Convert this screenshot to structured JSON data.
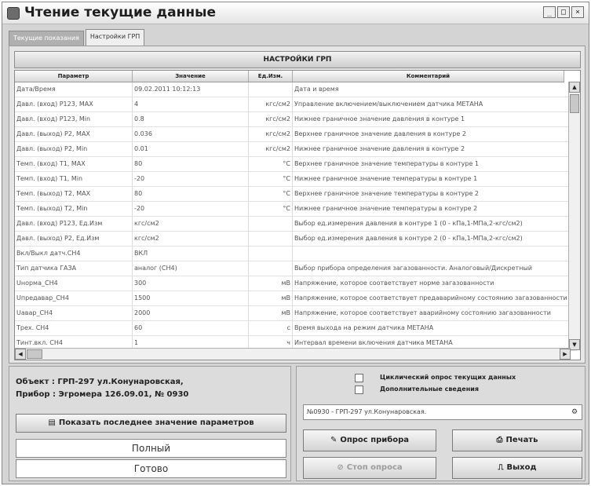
{
  "window": {
    "title": "Чтение текущие данные",
    "controls": {
      "minimize": "_",
      "maximize": "□",
      "close": "×"
    }
  },
  "tabs": [
    {
      "label": "Текущие показания",
      "active": false
    },
    {
      "label": "Настройки ГРП",
      "active": true
    }
  ],
  "settings": {
    "section_title": "НАСТРОЙКИ ГРП",
    "columns": [
      "Параметр",
      "Значение",
      "Ед.Изм.",
      "Комментарий"
    ],
    "rows": [
      [
        "Дата/Время",
        "09.02.2011 10:12:13",
        "",
        "Дата и время"
      ],
      [
        "Давл. (вход) Р123, MAX",
        "4",
        "кгс/см2",
        "Управление включением/выключением датчика МЕТАНА"
      ],
      [
        "Давл. (вход) Р123, Min",
        "0.8",
        "кгс/см2",
        "Нижнее граничное значение давления в контуре 1"
      ],
      [
        "Давл. (выход) Р2, MAX",
        "0.036",
        "кгс/см2",
        "Верхнее граничное значение давления в контуре 2"
      ],
      [
        "Давл. (выход) Р2, Min",
        "0.01",
        "кгс/см2",
        "Нижнее граничное значение давления в контуре 2"
      ],
      [
        "Темп. (вход) Т1, MAX",
        "80",
        "°C",
        "Верхнее граничное значение температуры в контуре 1"
      ],
      [
        "Темп. (вход) Т1, Min",
        "-20",
        "°C",
        "Нижнее граничное значение температуры в контуре 1"
      ],
      [
        "Темп. (выход) Т2, MAX",
        "80",
        "°C",
        "Верхнее граничное значение температуры в контуре 2"
      ],
      [
        "Темп. (выход) Т2, Min",
        "-20",
        "°C",
        "Нижнее граничное значение температуры в контуре 2"
      ],
      [
        "Давл. (вход) Р123, Ед.Изм",
        "кгс/см2",
        "",
        "Выбор ед.измерения давления в контуре 1 (0 - кПа,1-МПа,2-кгс/см2)"
      ],
      [
        "Давл. (выход) Р2, Ед.Изм",
        "кгс/см2",
        "",
        "Выбор ед.измерения давления в контуре 2 (0 - кПа,1-МПа,2-кгс/см2)"
      ],
      [
        "Вкл/Выкл датч.СН4",
        "ВКЛ",
        "",
        ""
      ],
      [
        "Тип датчика ГАЗА",
        "аналог (СН4)",
        "",
        "Выбор прибора определения загазованности. Аналоговый/Дискретный"
      ],
      [
        "Uнорма_СН4",
        "300",
        "мВ",
        "Напряжение, которое соответствует норме загазованности"
      ],
      [
        "Uпредавар_СН4",
        "1500",
        "мВ",
        "Напряжение, которое соответствует предаварийному состоянию загазованности"
      ],
      [
        "Uавар_СН4",
        "2000",
        "мВ",
        "Напряжение, которое соответствует аварийному состоянию загазованности"
      ],
      [
        "Трех. СН4",
        "60",
        "с",
        "Время выхода на режим датчика МЕТАНА"
      ],
      [
        "Тинт.вкл. СН4",
        "1",
        "ч",
        "Интервал времени включения датчика МЕТАНА"
      ]
    ]
  },
  "device": {
    "object_line": "Объект : ГРП-297 ул.Конунаровская,",
    "device_line": "Прибор : Эгромера 126.09.01, № 0930"
  },
  "buttons": {
    "show_last": "Показать последнее значение параметров",
    "poll": "Опрос прибора",
    "print": "Печать",
    "stop_poll": "Стоп опроса",
    "exit": "Выход"
  },
  "status": {
    "line1": "Полный",
    "line2": "Готово"
  },
  "options": {
    "cyclic_poll": "Циклический опрос текущих данных",
    "extra_info": "Дополнительные сведения"
  },
  "device_select": {
    "value": "№0930 - ГРП-297 ул.Конунаровская."
  }
}
